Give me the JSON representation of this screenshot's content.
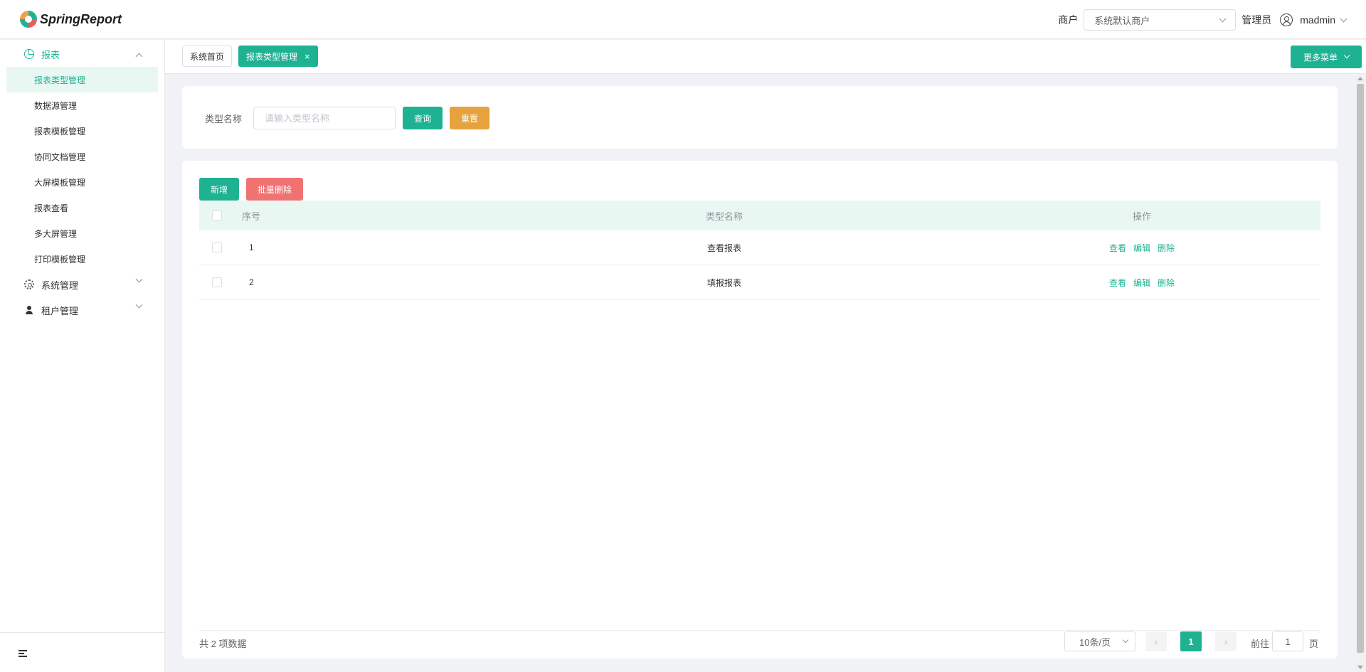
{
  "header": {
    "logo_text": "SpringReport",
    "tenant_label": "商户",
    "tenant_value": "系统默认商户",
    "role_label": "管理员",
    "user_name": "madmin"
  },
  "sidebar": {
    "groups": [
      {
        "label": "报表",
        "icon": "pie-chart-icon",
        "expanded": true
      },
      {
        "label": "系统管理",
        "icon": "gear-icon",
        "expanded": false
      },
      {
        "label": "租户管理",
        "icon": "person-icon",
        "expanded": false
      }
    ],
    "report_items": [
      "报表类型管理",
      "数据源管理",
      "报表模板管理",
      "协同文档管理",
      "大屏模板管理",
      "报表查看",
      "多大屏管理",
      "打印模板管理"
    ],
    "active_item": "报表类型管理"
  },
  "tabs": {
    "items": [
      {
        "label": "系统首页",
        "active": false
      },
      {
        "label": "报表类型管理",
        "active": true,
        "close": "×"
      }
    ],
    "more_menu": "更多菜单"
  },
  "search": {
    "label": "类型名称",
    "placeholder": "请输入类型名称",
    "value": "",
    "query_button": "查询",
    "reset_button": "重置"
  },
  "toolbar": {
    "add_button": "新增",
    "batch_delete_button": "批量删除"
  },
  "table": {
    "columns": [
      "序号",
      "类型名称",
      "操作"
    ],
    "rows": [
      {
        "no": "1",
        "name": "查看报表"
      },
      {
        "no": "2",
        "name": "填报报表"
      }
    ],
    "actions": [
      "查看",
      "编辑",
      "删除"
    ]
  },
  "pagination": {
    "total_text": "共 2 项数据",
    "page_size": "10条/页",
    "current_page": "1",
    "goto_label": "前往",
    "goto_value": "1",
    "goto_suffix": "页"
  },
  "colors": {
    "primary": "#1eb293",
    "warning": "#e6a23c",
    "danger": "#f07272",
    "table_header_bg": "#e9f7f3"
  }
}
